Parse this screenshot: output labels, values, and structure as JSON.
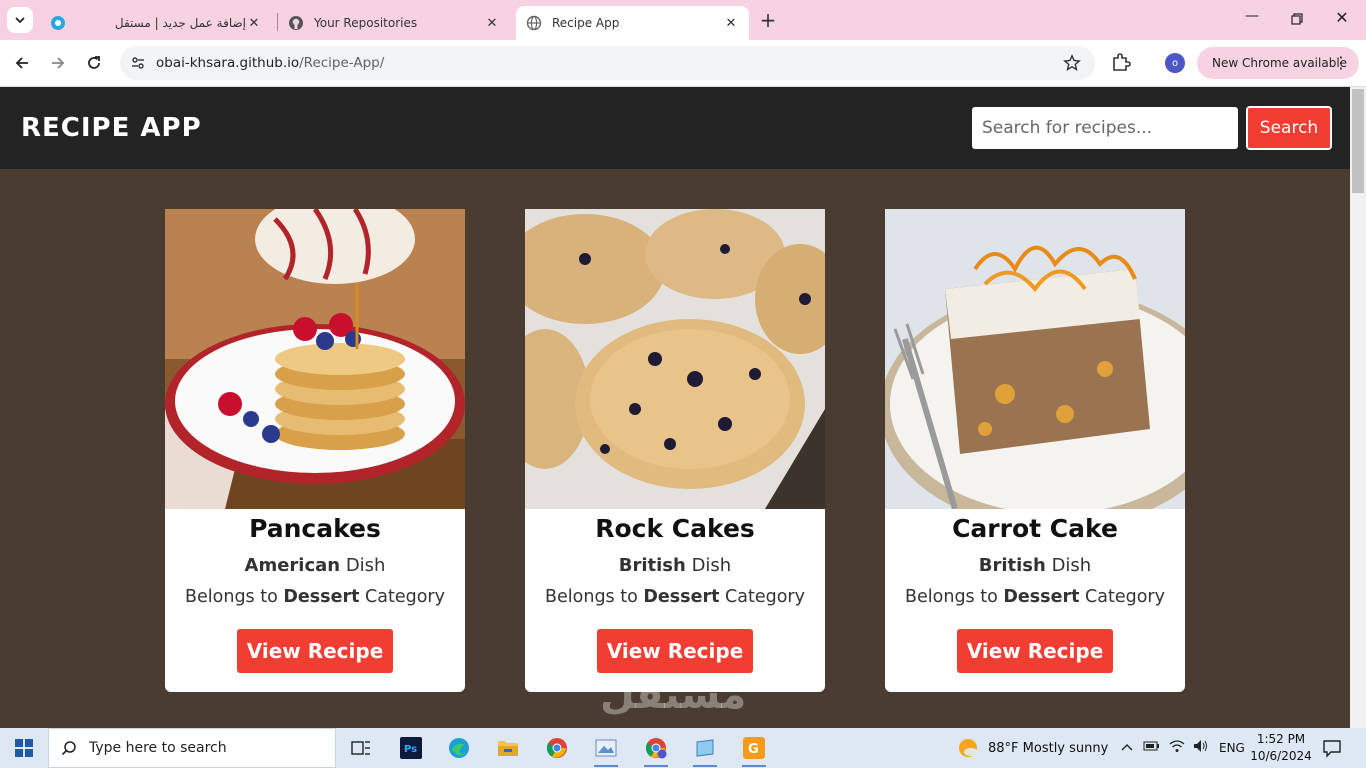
{
  "browser": {
    "tabs": [
      {
        "title": "إضافة عمل جديد | مستقل",
        "active": false
      },
      {
        "title": "Your Repositories",
        "active": false
      },
      {
        "title": "Recipe App",
        "active": true
      }
    ],
    "url_host": "obai-khsara.github.io",
    "url_path": "/Recipe-App/",
    "profile_initial": "o",
    "update_label": "New Chrome available"
  },
  "app": {
    "title": "RECIPE APP",
    "search_placeholder": "Search for recipes...",
    "search_button": "Search",
    "accent_color": "#f23d33",
    "header_color": "#232323",
    "background_color": "#4a3c31"
  },
  "recipes": [
    {
      "name": "Pancakes",
      "area": "American",
      "area_suffix": " Dish",
      "category_prefix": "Belongs to ",
      "category": "Dessert",
      "category_suffix": " Category",
      "button": "View Recipe"
    },
    {
      "name": "Rock Cakes",
      "area": "British",
      "area_suffix": " Dish",
      "category_prefix": "Belongs to ",
      "category": "Dessert",
      "category_suffix": " Category",
      "button": "View Recipe"
    },
    {
      "name": "Carrot Cake",
      "area": "British",
      "area_suffix": " Dish",
      "category_prefix": "Belongs to ",
      "category": "Dessert",
      "category_suffix": " Category",
      "button": "View Recipe"
    }
  ],
  "watermark": "مستقل",
  "taskbar": {
    "search_placeholder": "Type here to search",
    "weather": "88°F  Mostly sunny",
    "language": "ENG",
    "time": "1:52 PM",
    "date": "10/6/2024"
  }
}
